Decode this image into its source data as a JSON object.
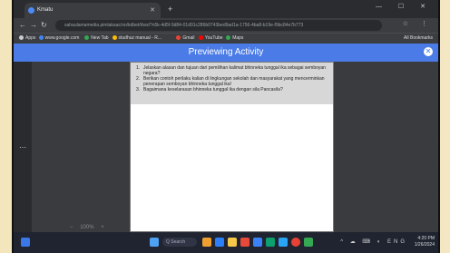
{
  "browser": {
    "tab_title": "Kmatu",
    "new_tab": "+",
    "window_controls": "— ☐ ✕",
    "url": "sahaulamamedia.pimlakaac/xn/kdbet/t/wst?n5k-4d5f-9d84-01d91c286b0743bed9ad1a-1756-4ba8-b19e-f9bc84e7b773",
    "nav": {
      "back": "←",
      "forward": "→",
      "reload": "↻"
    },
    "addr_right": "☆ ⋮",
    "bookmarks": [
      {
        "label": "Apps",
        "icon": "grid-icon",
        "color": "#cccccc"
      },
      {
        "label": "www.google.com",
        "icon": "google-icon",
        "color": "#4285f4"
      },
      {
        "label": "New Tab",
        "icon": "chrome-icon",
        "color": "#34a853"
      },
      {
        "label": "studhuz manual - R...",
        "icon": "bookmark-icon",
        "color": "#fbbc05"
      },
      {
        "label": "Gmail",
        "icon": "gmail-icon",
        "color": "#ea4335"
      },
      {
        "label": "YouTube",
        "icon": "youtube-icon",
        "color": "#ff0000"
      },
      {
        "label": "Maps",
        "icon": "maps-icon",
        "color": "#34a853"
      }
    ],
    "all_bookmarks": "All Bookmarks"
  },
  "header": {
    "title": "Previewing Activity",
    "close": "✕"
  },
  "sidebar": {
    "more": "⋯"
  },
  "questions": [
    {
      "num": "1.",
      "text": "Jelaskan alasan dan tujuan dari pemilihan kalimat bhinneka tunggal ika sebagai semboyan negara?"
    },
    {
      "num": "2.",
      "text": "Berikan contoh perilaku kalian di lingkungan sekolah dan masyarakat yang mencerminkan penerapan semboyan bhinneka tunggal ika!"
    },
    {
      "num": "3.",
      "text": "Bagaimana keselarasan bhinneka tunggal ika dengan sila Pancasila?"
    }
  ],
  "zoom": {
    "value": "100%",
    "minus": "−",
    "plus": "+"
  },
  "taskbar": {
    "search": "Q  Search",
    "tray_time": "4:20 PM",
    "tray_date": "1/26/2024",
    "tray_icons": "^ ☁ ⌨ ◐ ENG"
  }
}
